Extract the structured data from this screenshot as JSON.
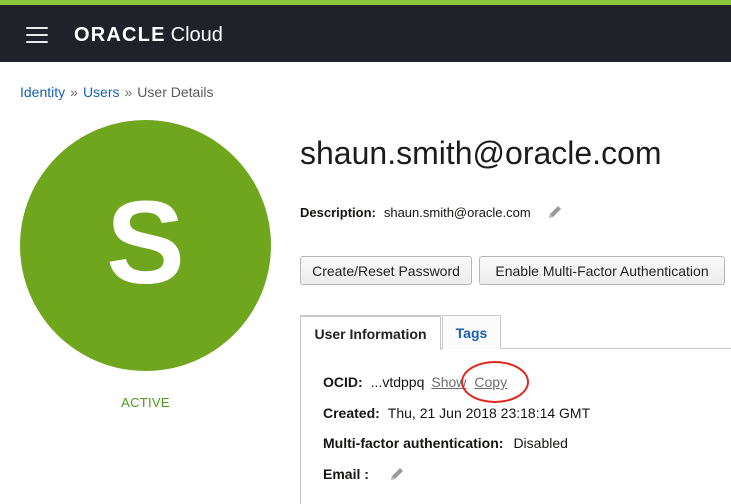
{
  "header": {
    "menu_icon": "hamburger-menu-icon",
    "brand_name": "ORACLE",
    "brand_product": "Cloud",
    "accent_color": "#8cc63f",
    "bar_color": "#1f2329"
  },
  "breadcrumb": {
    "items": [
      "Identity",
      "Users"
    ],
    "current": "User Details",
    "separator": "»"
  },
  "user": {
    "avatar_letter": "S",
    "avatar_color": "#6fa61e",
    "status": "ACTIVE",
    "name": "shaun.smith@oracle.com",
    "description_label": "Description:",
    "description_value": "shaun.smith@oracle.com",
    "edit_icon": "pencil-icon"
  },
  "actions": {
    "reset_password": "Create/Reset Password",
    "enable_mfa": "Enable Multi-Factor Authentication"
  },
  "tabs": {
    "items": [
      "User Information",
      "Tags"
    ],
    "active": "User Information"
  },
  "info": {
    "ocid_label": "OCID:",
    "ocid_value": "...vtdppq",
    "show_link": "Show",
    "copy_link": "Copy",
    "created_label": "Created:",
    "created_value": "Thu, 21 Jun 2018 23:18:14 GMT",
    "mfa_label": "Multi-factor authentication:",
    "mfa_value": "Disabled",
    "email_label": "Email :",
    "email_edit_icon": "pencil-icon"
  }
}
